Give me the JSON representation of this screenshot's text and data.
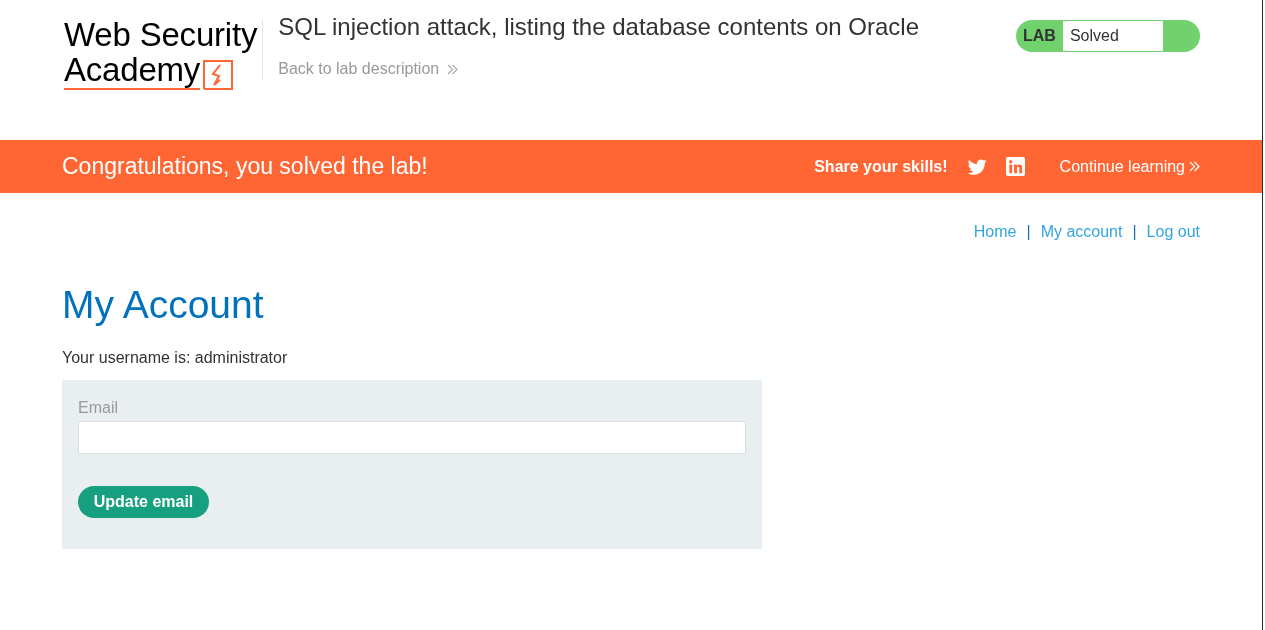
{
  "header": {
    "logo": {
      "lines": [
        "Web Security",
        "Academy"
      ]
    },
    "title": "SQL injection attack, listing the database contents on Oracle",
    "back_link": "Back to lab description",
    "lab_status": {
      "label": "LAB",
      "status": "Solved",
      "solved": true
    }
  },
  "banner": {
    "message": "Congratulations, you solved the lab!",
    "share_label": "Share your skills!",
    "share_links": [
      {
        "kind": "twitter"
      },
      {
        "kind": "linkedin"
      }
    ],
    "continue_link": "Continue learning"
  },
  "nav": [
    {
      "kind": "link",
      "label": "Home"
    },
    {
      "kind": "separator",
      "label": "|"
    },
    {
      "kind": "link",
      "label": "My account"
    },
    {
      "kind": "separator",
      "label": "|"
    },
    {
      "kind": "link",
      "label": "Log out"
    }
  ],
  "page": {
    "heading": "My Account",
    "username_text": "Your username is: administrator",
    "form": {
      "email_label": "Email",
      "button": "Update email"
    }
  }
}
